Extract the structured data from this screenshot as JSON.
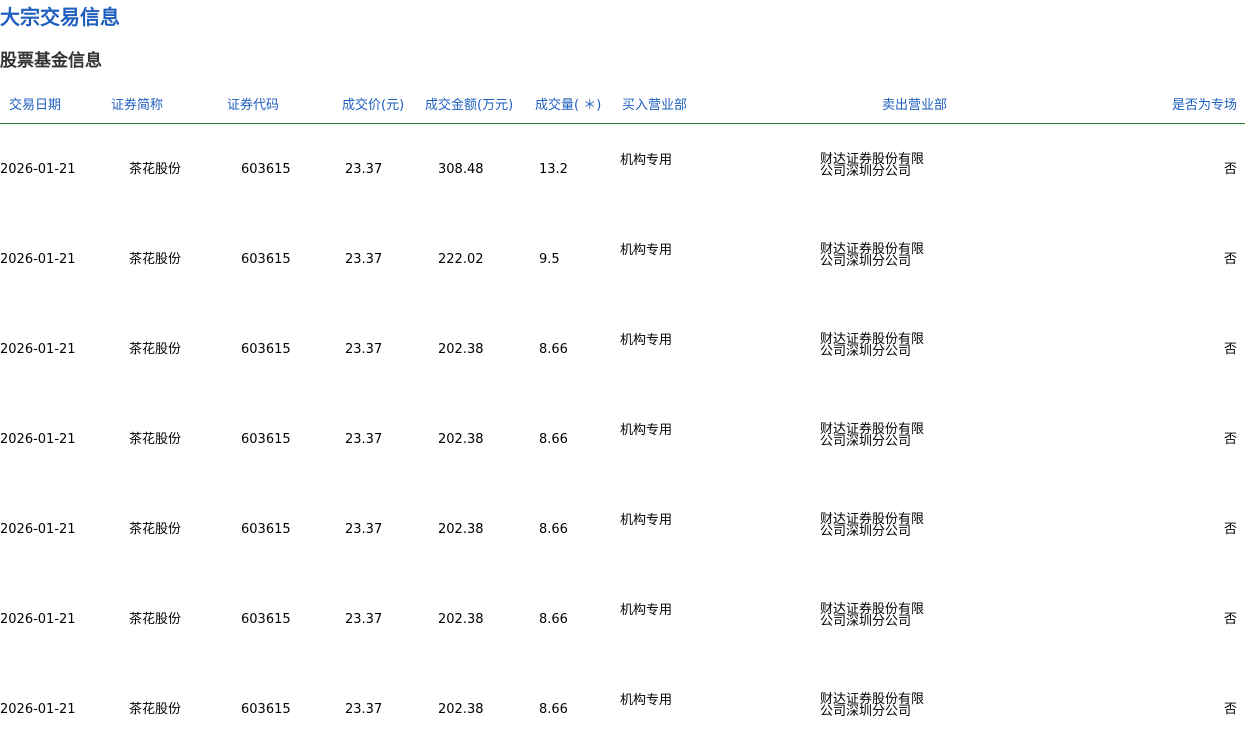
{
  "page": {
    "title": "大宗交易信息",
    "section_title": "股票基金信息"
  },
  "table": {
    "headers": {
      "date": "交易日期",
      "name": "证券简称",
      "code": "证券代码",
      "price": "成交价(元)",
      "amount": "成交金额(万元)",
      "volume": "成交量( ＊)",
      "buyer": "买入营业部",
      "seller": "卖出营业部",
      "special": "是否为专场"
    },
    "rows": [
      {
        "date": "2026-01-21",
        "name": "茶花股份",
        "code": "603615",
        "price": "23.37",
        "amount": "308.48",
        "volume": "13.2",
        "buyer": "机构专用",
        "seller": "财达证券股份有限公司深圳分公司",
        "special": "否"
      },
      {
        "date": "2026-01-21",
        "name": "茶花股份",
        "code": "603615",
        "price": "23.37",
        "amount": "222.02",
        "volume": "9.5",
        "buyer": "机构专用",
        "seller": "财达证券股份有限公司深圳分公司",
        "special": "否"
      },
      {
        "date": "2026-01-21",
        "name": "茶花股份",
        "code": "603615",
        "price": "23.37",
        "amount": "202.38",
        "volume": "8.66",
        "buyer": "机构专用",
        "seller": "财达证券股份有限公司深圳分公司",
        "special": "否"
      },
      {
        "date": "2026-01-21",
        "name": "茶花股份",
        "code": "603615",
        "price": "23.37",
        "amount": "202.38",
        "volume": "8.66",
        "buyer": "机构专用",
        "seller": "财达证券股份有限公司深圳分公司",
        "special": "否"
      },
      {
        "date": "2026-01-21",
        "name": "茶花股份",
        "code": "603615",
        "price": "23.37",
        "amount": "202.38",
        "volume": "8.66",
        "buyer": "机构专用",
        "seller": "财达证券股份有限公司深圳分公司",
        "special": "否"
      },
      {
        "date": "2026-01-21",
        "name": "茶花股份",
        "code": "603615",
        "price": "23.37",
        "amount": "202.38",
        "volume": "8.66",
        "buyer": "机构专用",
        "seller": "财达证券股份有限公司深圳分公司",
        "special": "否"
      },
      {
        "date": "2026-01-21",
        "name": "茶花股份",
        "code": "603615",
        "price": "23.37",
        "amount": "202.38",
        "volume": "8.66",
        "buyer": "机构专用",
        "seller": "财达证券股份有限公司深圳分公司",
        "special": "否"
      }
    ]
  },
  "colors": {
    "title": "#1f5fbf",
    "header_text": "#1f5fbf",
    "header_border": "#2a7a3a",
    "section_title": "#333333"
  }
}
